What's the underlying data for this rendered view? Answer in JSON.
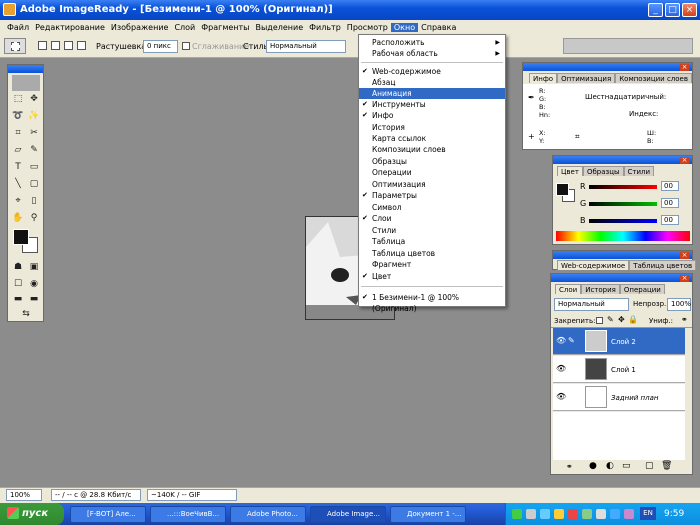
{
  "window": {
    "title": "Adobe ImageReady - [Безимени-1 @ 100% (Оригинал)]",
    "min": "_",
    "max": "□",
    "close": "×"
  },
  "menubar": [
    "Файл",
    "Редактирование",
    "Изображение",
    "Слой",
    "Фрагменты",
    "Выделение",
    "Фильтр",
    "Просмотр",
    "Окно",
    "Справка"
  ],
  "options": {
    "feather_label": "Растушевка:",
    "feather_value": "0 пикс",
    "antialias_label": "Сглаживание",
    "style_label": "Стиль:",
    "style_value": "Нормальный"
  },
  "window_menu": {
    "items": [
      {
        "label": "Расположить",
        "check": "",
        "arrow": "▶"
      },
      {
        "label": "Рабочая область",
        "check": "",
        "arrow": "▶"
      },
      {
        "label": "Web-содержимое",
        "check": "✔",
        "arrow": ""
      },
      {
        "label": "Абзац",
        "check": "",
        "arrow": ""
      },
      {
        "label": "Анимация",
        "check": "",
        "arrow": ""
      },
      {
        "label": "Инструменты",
        "check": "✔",
        "arrow": ""
      },
      {
        "label": "Инфо",
        "check": "✔",
        "arrow": ""
      },
      {
        "label": "История",
        "check": "",
        "arrow": ""
      },
      {
        "label": "Карта ссылок",
        "check": "",
        "arrow": ""
      },
      {
        "label": "Композиции слоев",
        "check": "",
        "arrow": ""
      },
      {
        "label": "Образцы",
        "check": "",
        "arrow": ""
      },
      {
        "label": "Операции",
        "check": "",
        "arrow": ""
      },
      {
        "label": "Оптимизация",
        "check": "",
        "arrow": ""
      },
      {
        "label": "Параметры",
        "check": "✔",
        "arrow": ""
      },
      {
        "label": "Символ",
        "check": "",
        "arrow": ""
      },
      {
        "label": "Слои",
        "check": "✔",
        "arrow": ""
      },
      {
        "label": "Стили",
        "check": "",
        "arrow": ""
      },
      {
        "label": "Таблица",
        "check": "",
        "arrow": ""
      },
      {
        "label": "Таблица цветов",
        "check": "",
        "arrow": ""
      },
      {
        "label": "Фрагмент",
        "check": "",
        "arrow": ""
      },
      {
        "label": "Цвет",
        "check": "✔",
        "arrow": ""
      },
      {
        "label": "1 Безимени-1 @ 100% (Оригинал)",
        "check": "✔",
        "arrow": ""
      }
    ],
    "highlighted": "Анимация"
  },
  "info_panel": {
    "tabs": [
      "Инфо",
      "Оптимизация",
      "Композиции слоев"
    ],
    "rgb": [
      "R:",
      "G:",
      "B:",
      "Hn:"
    ],
    "hex_label": "Шестнадцатиричный:",
    "index_label": "Индекс:",
    "xy": [
      "X:",
      "Y:"
    ],
    "wh": [
      "Ш:",
      "В:"
    ]
  },
  "color_panel": {
    "tabs": [
      "Цвет",
      "Образцы",
      "Стили"
    ],
    "channels": [
      {
        "label": "R",
        "value": "00"
      },
      {
        "label": "G",
        "value": "00"
      },
      {
        "label": "B",
        "value": "00"
      }
    ],
    "colors": {
      "r": "#ff0000",
      "g": "#00c000",
      "b": "#0000ff"
    }
  },
  "web_panel": {
    "tabs": [
      "Web-содержимое",
      "Таблица цветов"
    ]
  },
  "layers_panel": {
    "tabs": [
      "Слои",
      "История",
      "Операции"
    ],
    "blend": "Нормальный",
    "opacity_label": "Непрозр.:",
    "opacity": "100%",
    "lock_label": "Закрепить:",
    "fill_label": "Униф.:",
    "layers": [
      "Слой 2",
      "Слой 1",
      "Задний план"
    ]
  },
  "status": {
    "zoom": "100%",
    "speed": "-- / -- c @ 28.8 Кбит/с",
    "size": "~140K / -- GIF"
  },
  "taskbar": {
    "start": "пуск",
    "buttons": [
      "[F-BOT] Але...",
      "...:::ВоеЧивВ...",
      "Adobe Photo...",
      "Adobe Image...",
      "Документ 1 -..."
    ],
    "lang": "EN",
    "clock": "9:59"
  }
}
